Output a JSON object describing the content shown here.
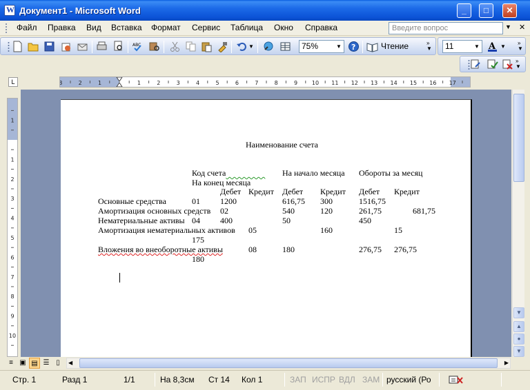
{
  "window": {
    "title": "Документ1 - Microsoft Word"
  },
  "menu": {
    "items": [
      "Файл",
      "Правка",
      "Вид",
      "Вставка",
      "Формат",
      "Сервис",
      "Таблица",
      "Окно",
      "Справка"
    ],
    "ask_placeholder": "Введите вопрос"
  },
  "toolbar": {
    "zoom": "75%",
    "reading_label": "Чтение",
    "font_size": "11"
  },
  "document": {
    "heading": "Наименование счета",
    "header_row1": {
      "code": "Код счета",
      "start": "На начало месяца",
      "turnover": "Обороты за месяц"
    },
    "header_row2": "На конец месяца",
    "subheaders": [
      "Дебет",
      "Кредит",
      "Дебет",
      "Кредит",
      "Дебет",
      "Кредит"
    ],
    "rows": [
      {
        "name": "Основные средства",
        "code": "01",
        "c1": "1200",
        "c2": "",
        "c3": "616,75",
        "c4": "300",
        "c5": "1516,75",
        "c6": ""
      },
      {
        "name": "Амортизация основных средств",
        "code": "02",
        "c1": "",
        "c2": "",
        "c3": "540",
        "c4": "120",
        "c5": "261,75",
        "c6": "681,75"
      },
      {
        "name": "Нематериальные активы",
        "code": "04",
        "c1": "400",
        "c2": "",
        "c3": "50",
        "c4": "",
        "c5": "450",
        "c6": ""
      },
      {
        "name": "Амортизация нематериальных активов",
        "code": "05",
        "c1": "",
        "c2": "",
        "c3": "",
        "c4": "160",
        "c5": "",
        "c6": "15"
      },
      {
        "name": "175",
        "code": "",
        "c1": "",
        "c2": "",
        "c3": "",
        "c4": "",
        "c5": "",
        "c6": ""
      },
      {
        "name": "Вложения во внеоборотные активы",
        "code": "08",
        "c1": "",
        "c2": "",
        "c3": "180",
        "c4": "",
        "c5": "276,75",
        "c6": "276,75"
      },
      {
        "name": "180",
        "code": "",
        "c1": "",
        "c2": "",
        "c3": "",
        "c4": "",
        "c5": "",
        "c6": ""
      }
    ]
  },
  "ruler": {
    "labels": [
      "3",
      "2",
      "1",
      "1",
      "2",
      "3",
      "4",
      "5",
      "6",
      "7",
      "8",
      "9",
      "10",
      "11",
      "12",
      "13",
      "14",
      "15",
      "16",
      "17"
    ]
  },
  "vruler": {
    "labels": [
      "2",
      "1",
      "1",
      "2",
      "3",
      "4",
      "5",
      "6",
      "7",
      "8",
      "9",
      "10",
      "11"
    ]
  },
  "status": {
    "page": "Стр. 1",
    "section": "Разд 1",
    "pages": "1/1",
    "at": "На 8,3см",
    "line": "Ст 14",
    "col": "Кол 1",
    "rec": "ЗАП",
    "trk": "ИСПР",
    "ext": "ВДЛ",
    "ovr": "ЗАМ",
    "lang": "русский (Ро"
  }
}
